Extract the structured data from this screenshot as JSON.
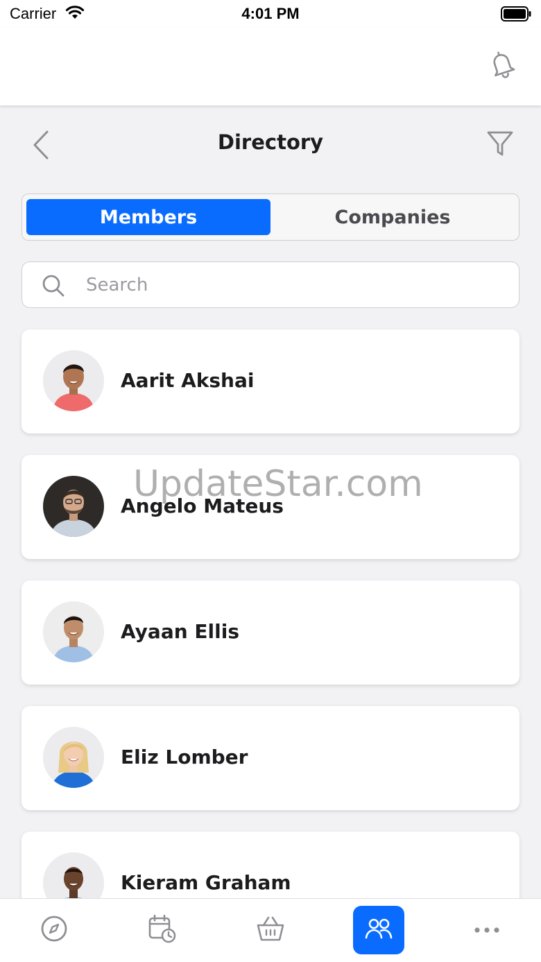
{
  "status_bar": {
    "carrier": "Carrier",
    "time": "4:01 PM"
  },
  "header": {
    "title": "Directory",
    "icons": {
      "notifications": "bell-icon",
      "back": "chevron-left-icon",
      "filter": "filter-icon"
    }
  },
  "segmented_control": {
    "members_label": "Members",
    "companies_label": "Companies",
    "selected": "Members"
  },
  "search": {
    "placeholder": "Search",
    "value": ""
  },
  "members": [
    {
      "name": "Aarit Akshai"
    },
    {
      "name": "Angelo Mateus"
    },
    {
      "name": "Ayaan Ellis"
    },
    {
      "name": "Eliz Lomber"
    },
    {
      "name": "Kieram Graham"
    }
  ],
  "watermark": "UpdateStar.com",
  "tab_bar": {
    "tabs": [
      {
        "icon": "compass-icon",
        "active": false
      },
      {
        "icon": "calendar-clock-icon",
        "active": false
      },
      {
        "icon": "basket-icon",
        "active": false
      },
      {
        "icon": "people-icon",
        "active": true
      },
      {
        "icon": "more-icon",
        "active": false
      }
    ]
  },
  "colors": {
    "accent": "#0a6cff",
    "background": "#f2f2f4",
    "card": "#ffffff",
    "text": "#1c1c1e",
    "muted": "#9a9aa0"
  }
}
